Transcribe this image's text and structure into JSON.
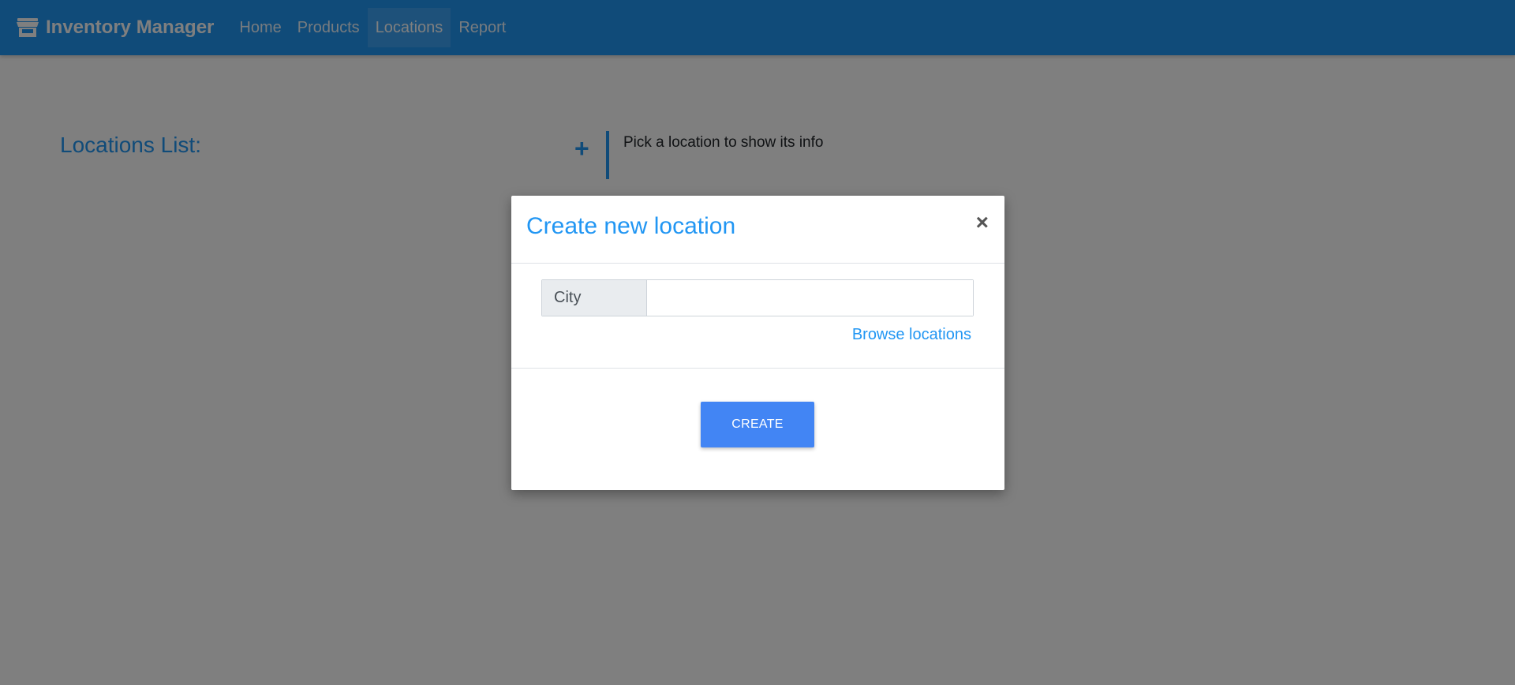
{
  "navbar": {
    "brand": "Inventory Manager",
    "brand_icon": "store-icon",
    "items": [
      {
        "label": "Home",
        "active": false
      },
      {
        "label": "Products",
        "active": false
      },
      {
        "label": "Locations",
        "active": true
      },
      {
        "label": "Report",
        "active": false
      }
    ],
    "color": "#2196f3"
  },
  "page": {
    "list_title": "Locations List:",
    "add_icon": "plus-icon",
    "pick_text": "Pick a location to show its info"
  },
  "modal": {
    "title": "Create new location",
    "close_symbol": "×",
    "city_label": "City",
    "city_value": "",
    "city_placeholder": "",
    "browse_link": "Browse locations",
    "create_button": "CREATE",
    "button_color": "#4285f4"
  }
}
